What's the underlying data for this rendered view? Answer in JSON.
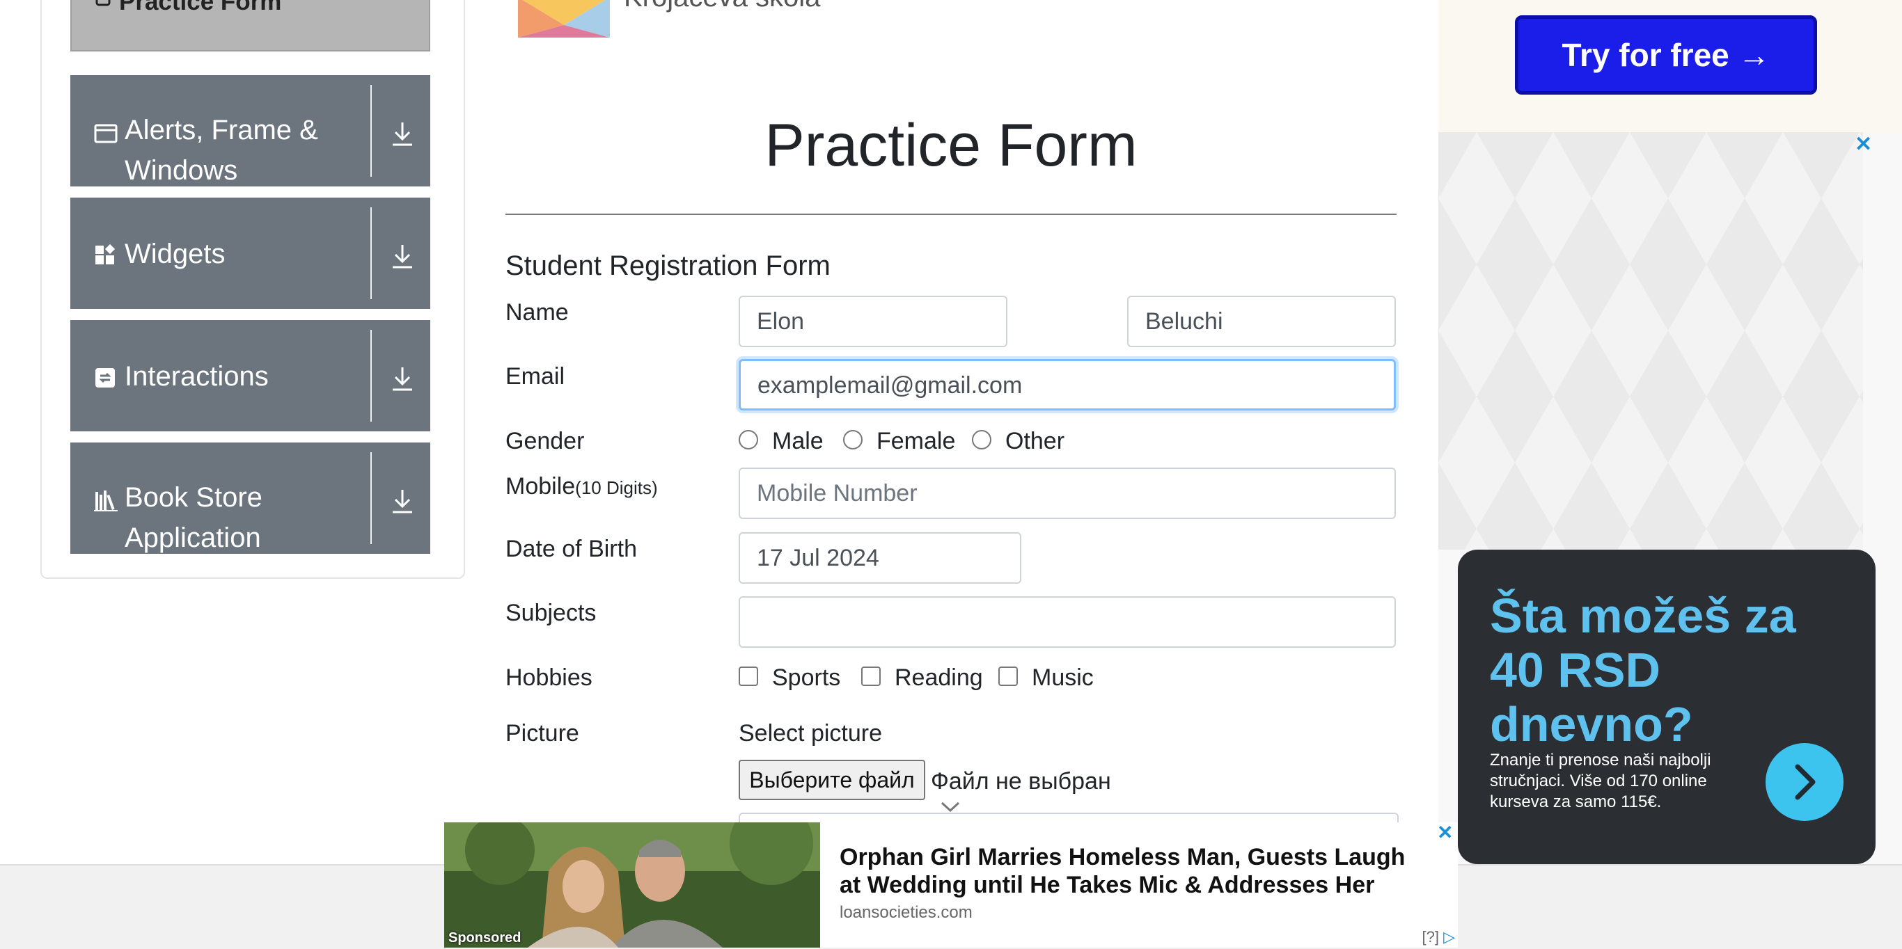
{
  "sidebar": {
    "active_item": "Practice Form",
    "items": [
      {
        "label_line1": "Alerts, Frame &",
        "label_line2": "Windows",
        "icon": "window-icon"
      },
      {
        "label_line1": "Widgets",
        "label_line2": "",
        "icon": "widgets-icon"
      },
      {
        "label_line1": "Interactions",
        "label_line2": "",
        "icon": "interactions-icon"
      },
      {
        "label_line1": "Book Store",
        "label_line2": "Application",
        "icon": "books-icon"
      }
    ]
  },
  "header": {
    "logo_text": "Krojačeva škola"
  },
  "form": {
    "page_title": "Practice Form",
    "heading": "Student Registration Form",
    "name_label": "Name",
    "first_name": "Elon",
    "last_name": "Beluchi",
    "email_label": "Email",
    "email_value": "examplemail@gmail.com",
    "gender_label": "Gender",
    "gender_options": [
      "Male",
      "Female",
      "Other"
    ],
    "mobile_label": "Mobile",
    "mobile_hint": "(10 Digits)",
    "mobile_placeholder": "Mobile Number",
    "dob_label": "Date of Birth",
    "dob_value": "17 Jul 2024",
    "subjects_label": "Subjects",
    "subjects_value": "",
    "hobbies_label": "Hobbies",
    "hobby_options": [
      "Sports",
      "Reading",
      "Music"
    ],
    "picture_label": "Picture",
    "select_picture": "Select picture",
    "file_button": "Выберите файл",
    "file_status": "Файл не выбран"
  },
  "ads": {
    "try_button": "Try for free →",
    "dark_headline": "Šta možeš za 40 RSD dnevno?",
    "dark_body": "Znanje ti prenose naši najbolji stručnjaci. Više od 170 online kurseva za samo 115€.",
    "bottom_sponsored": "Sponsored",
    "bottom_headline": "Orphan Girl Marries Homeless Man, Guests Laugh at Wedding until He Takes Mic & Addresses Her",
    "bottom_source": "loansocieties.com",
    "bottom_info": "[?]",
    "close_symbol": "✕"
  },
  "colors": {
    "sidebar_bg": "#6c757d",
    "focus_border": "#80bdff",
    "try_button_bg": "#1b1ee8",
    "ad_accent": "#5ec1ee"
  }
}
